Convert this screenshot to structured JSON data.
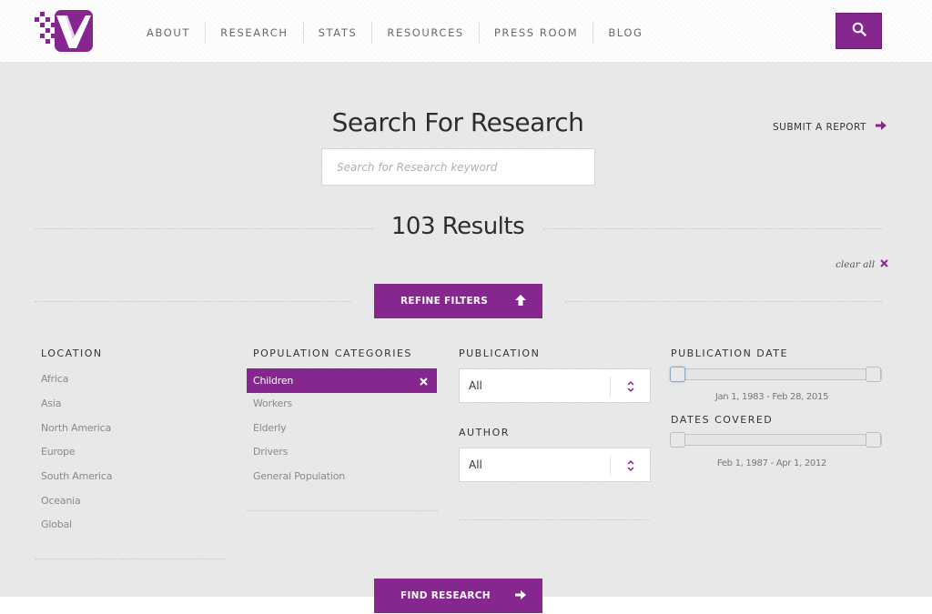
{
  "nav": {
    "items": [
      "ABOUT",
      "RESEARCH",
      "STATS",
      "RESOURCES",
      "PRESS ROOM",
      "BLOG"
    ]
  },
  "page": {
    "title": "Search For Research",
    "submit_report": "SUBMIT A REPORT",
    "search_placeholder": "Search for Research keyword",
    "results": "103 Results",
    "clear_all": "clear all",
    "refine_filters": "REFINE FILTERS",
    "find_research": "FIND RESEARCH"
  },
  "filters": {
    "location": {
      "heading": "LOCATION",
      "items": [
        "Africa",
        "Asia",
        "North America",
        "Europe",
        "South America",
        "Oceania",
        "Global"
      ]
    },
    "population": {
      "heading": "POPULATION CATEGORIES",
      "selected": "Children",
      "items": [
        "Workers",
        "Elderly",
        "Drivers",
        "General Population"
      ]
    },
    "publication": {
      "heading": "PUBLICATION",
      "value": "All"
    },
    "author": {
      "heading": "AUTHOR",
      "value": "All"
    },
    "publication_date": {
      "heading": "PUBLICATION DATE",
      "range": "Jan 1, 1983 - Feb 28, 2015"
    },
    "dates_covered": {
      "heading": "DATES COVERED",
      "range": "Feb 1, 1987 - Apr 1, 2012"
    }
  },
  "colors": {
    "accent": "#86278f",
    "background": "#e9e9e9"
  },
  "icons": {
    "logo": "v-checkmark-logo",
    "search": "magnifier-icon",
    "arrow": "arrow-right-icon",
    "up": "arrow-up-icon",
    "close": "close-icon",
    "select": "chevron-up-down-icon"
  }
}
